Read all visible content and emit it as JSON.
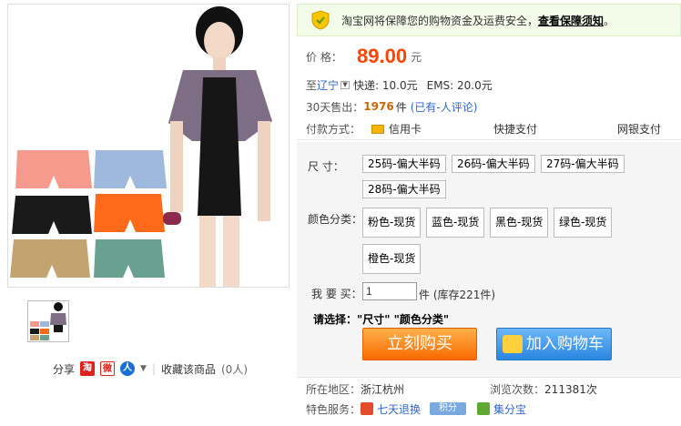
{
  "notice": {
    "text": "淘宝网将保障您的购物资金及运费安全，",
    "link": "查看保障须知",
    "end": "。"
  },
  "price": {
    "label": "价  格：",
    "value": "89.00",
    "unit": "元"
  },
  "shipping": {
    "prefix": "至",
    "region": "辽宁",
    "express": "快递: 10.0元",
    "ems": "EMS: 20.0元"
  },
  "sales": {
    "label": "30天售出：",
    "count": "1976",
    "unit": "件",
    "reviews": "(已有-人评论)"
  },
  "payment": {
    "label": "付款方式：",
    "credit": "信用卡",
    "express_pay": "快捷支付",
    "bank": "网银支付"
  },
  "options": {
    "size_label": "尺  寸：",
    "sizes": [
      "25码-偏大半码",
      "26码-偏大半码",
      "27码-偏大半码",
      "28码-偏大半码"
    ],
    "color_label": "颜色分类：",
    "colors": [
      "粉色-现货",
      "蓝色-现货",
      "黑色-现货",
      "绿色-现货",
      "橙色-现货"
    ],
    "qty_label": "我 要 买：",
    "qty_value": "1",
    "stock": "件 (库存221件)",
    "please": "请选择：\"尺寸\" \"颜色分类\""
  },
  "buttons": {
    "buy": "立刻购买",
    "cart": "加入购物车"
  },
  "location": {
    "label": "所在地区：",
    "value": "浙江杭州",
    "views_label": "浏览次数：",
    "views": "211381次"
  },
  "services": {
    "label": "特色服务：",
    "return7": "七天退换",
    "jifen": "积分",
    "jfb": "集分宝"
  },
  "share": {
    "label": "分享",
    "favorite": "收藏该商品",
    "fav_count": "(0人)"
  },
  "colors": {
    "price": "#ff4400",
    "buy_button": "#f86a00",
    "cart_button": "#2a86e0"
  }
}
